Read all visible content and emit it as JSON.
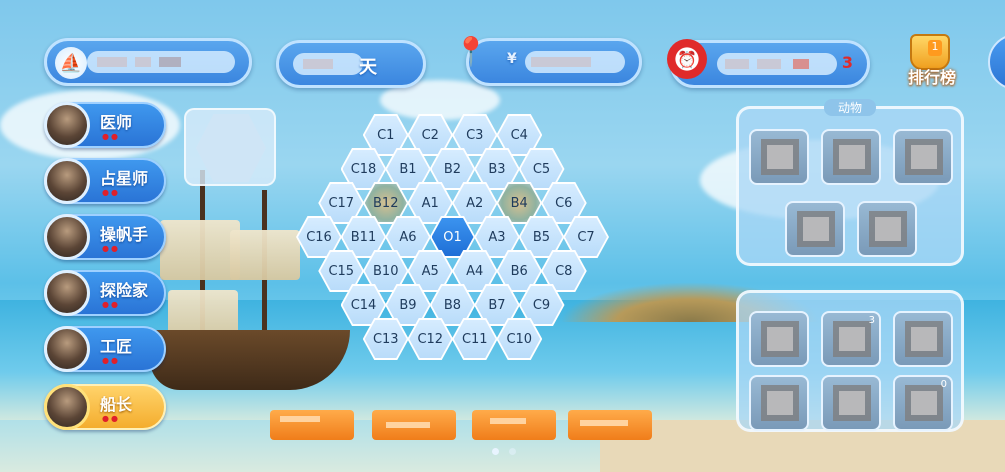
{
  "top_bar": {
    "boat": {
      "icon": "sailboat-icon",
      "value_hidden": true
    },
    "day": {
      "label": "天"
    },
    "location": {
      "icon": "location-pin-icon",
      "prefix": "¥"
    },
    "timer": {
      "icon": "alarm-clock-icon",
      "suffix": "3"
    },
    "ranking": {
      "label": "排行榜",
      "badge": "1",
      "icon": "trophy-icon"
    }
  },
  "characters": [
    {
      "name": "医师",
      "dots": "●●",
      "active": false
    },
    {
      "name": "占星师",
      "dots": "●●",
      "active": false
    },
    {
      "name": "操帆手",
      "dots": "●●",
      "active": false
    },
    {
      "name": "探险家",
      "dots": "●●",
      "active": false
    },
    {
      "name": "工匠",
      "dots": "●●",
      "active": false
    },
    {
      "name": "船长",
      "dots": "●●",
      "active": true
    }
  ],
  "hex_grid": {
    "rows": [
      [
        "C1",
        "C2",
        "C3",
        "C4"
      ],
      [
        "C18",
        "B1",
        "B2",
        "B3",
        "C5"
      ],
      [
        "C17",
        "B12",
        "A1",
        "A2",
        "B4",
        "C6"
      ],
      [
        "C16",
        "B11",
        "A6",
        "O1",
        "A3",
        "B5",
        "C7"
      ],
      [
        "C15",
        "B10",
        "A5",
        "A4",
        "B6",
        "C8"
      ],
      [
        "C14",
        "B9",
        "B8",
        "B7",
        "C9"
      ],
      [
        "C13",
        "C12",
        "C11",
        "C10"
      ]
    ],
    "center": "O1",
    "tiles_with_image": [
      "B12",
      "B4"
    ]
  },
  "right_panels": {
    "top_title": "动物",
    "top_slots": 5,
    "bottom_slots": [
      {
        "count": ""
      },
      {
        "count": "3"
      },
      {
        "count": ""
      },
      {
        "count": ""
      },
      {
        "count": ""
      },
      {
        "count": "0"
      }
    ]
  },
  "colors": {
    "pill_blue": "#3b86df",
    "active_gold": "#f4ad2e",
    "center_hex": "#1f6fd6",
    "action_orange": "#f07d1a"
  }
}
